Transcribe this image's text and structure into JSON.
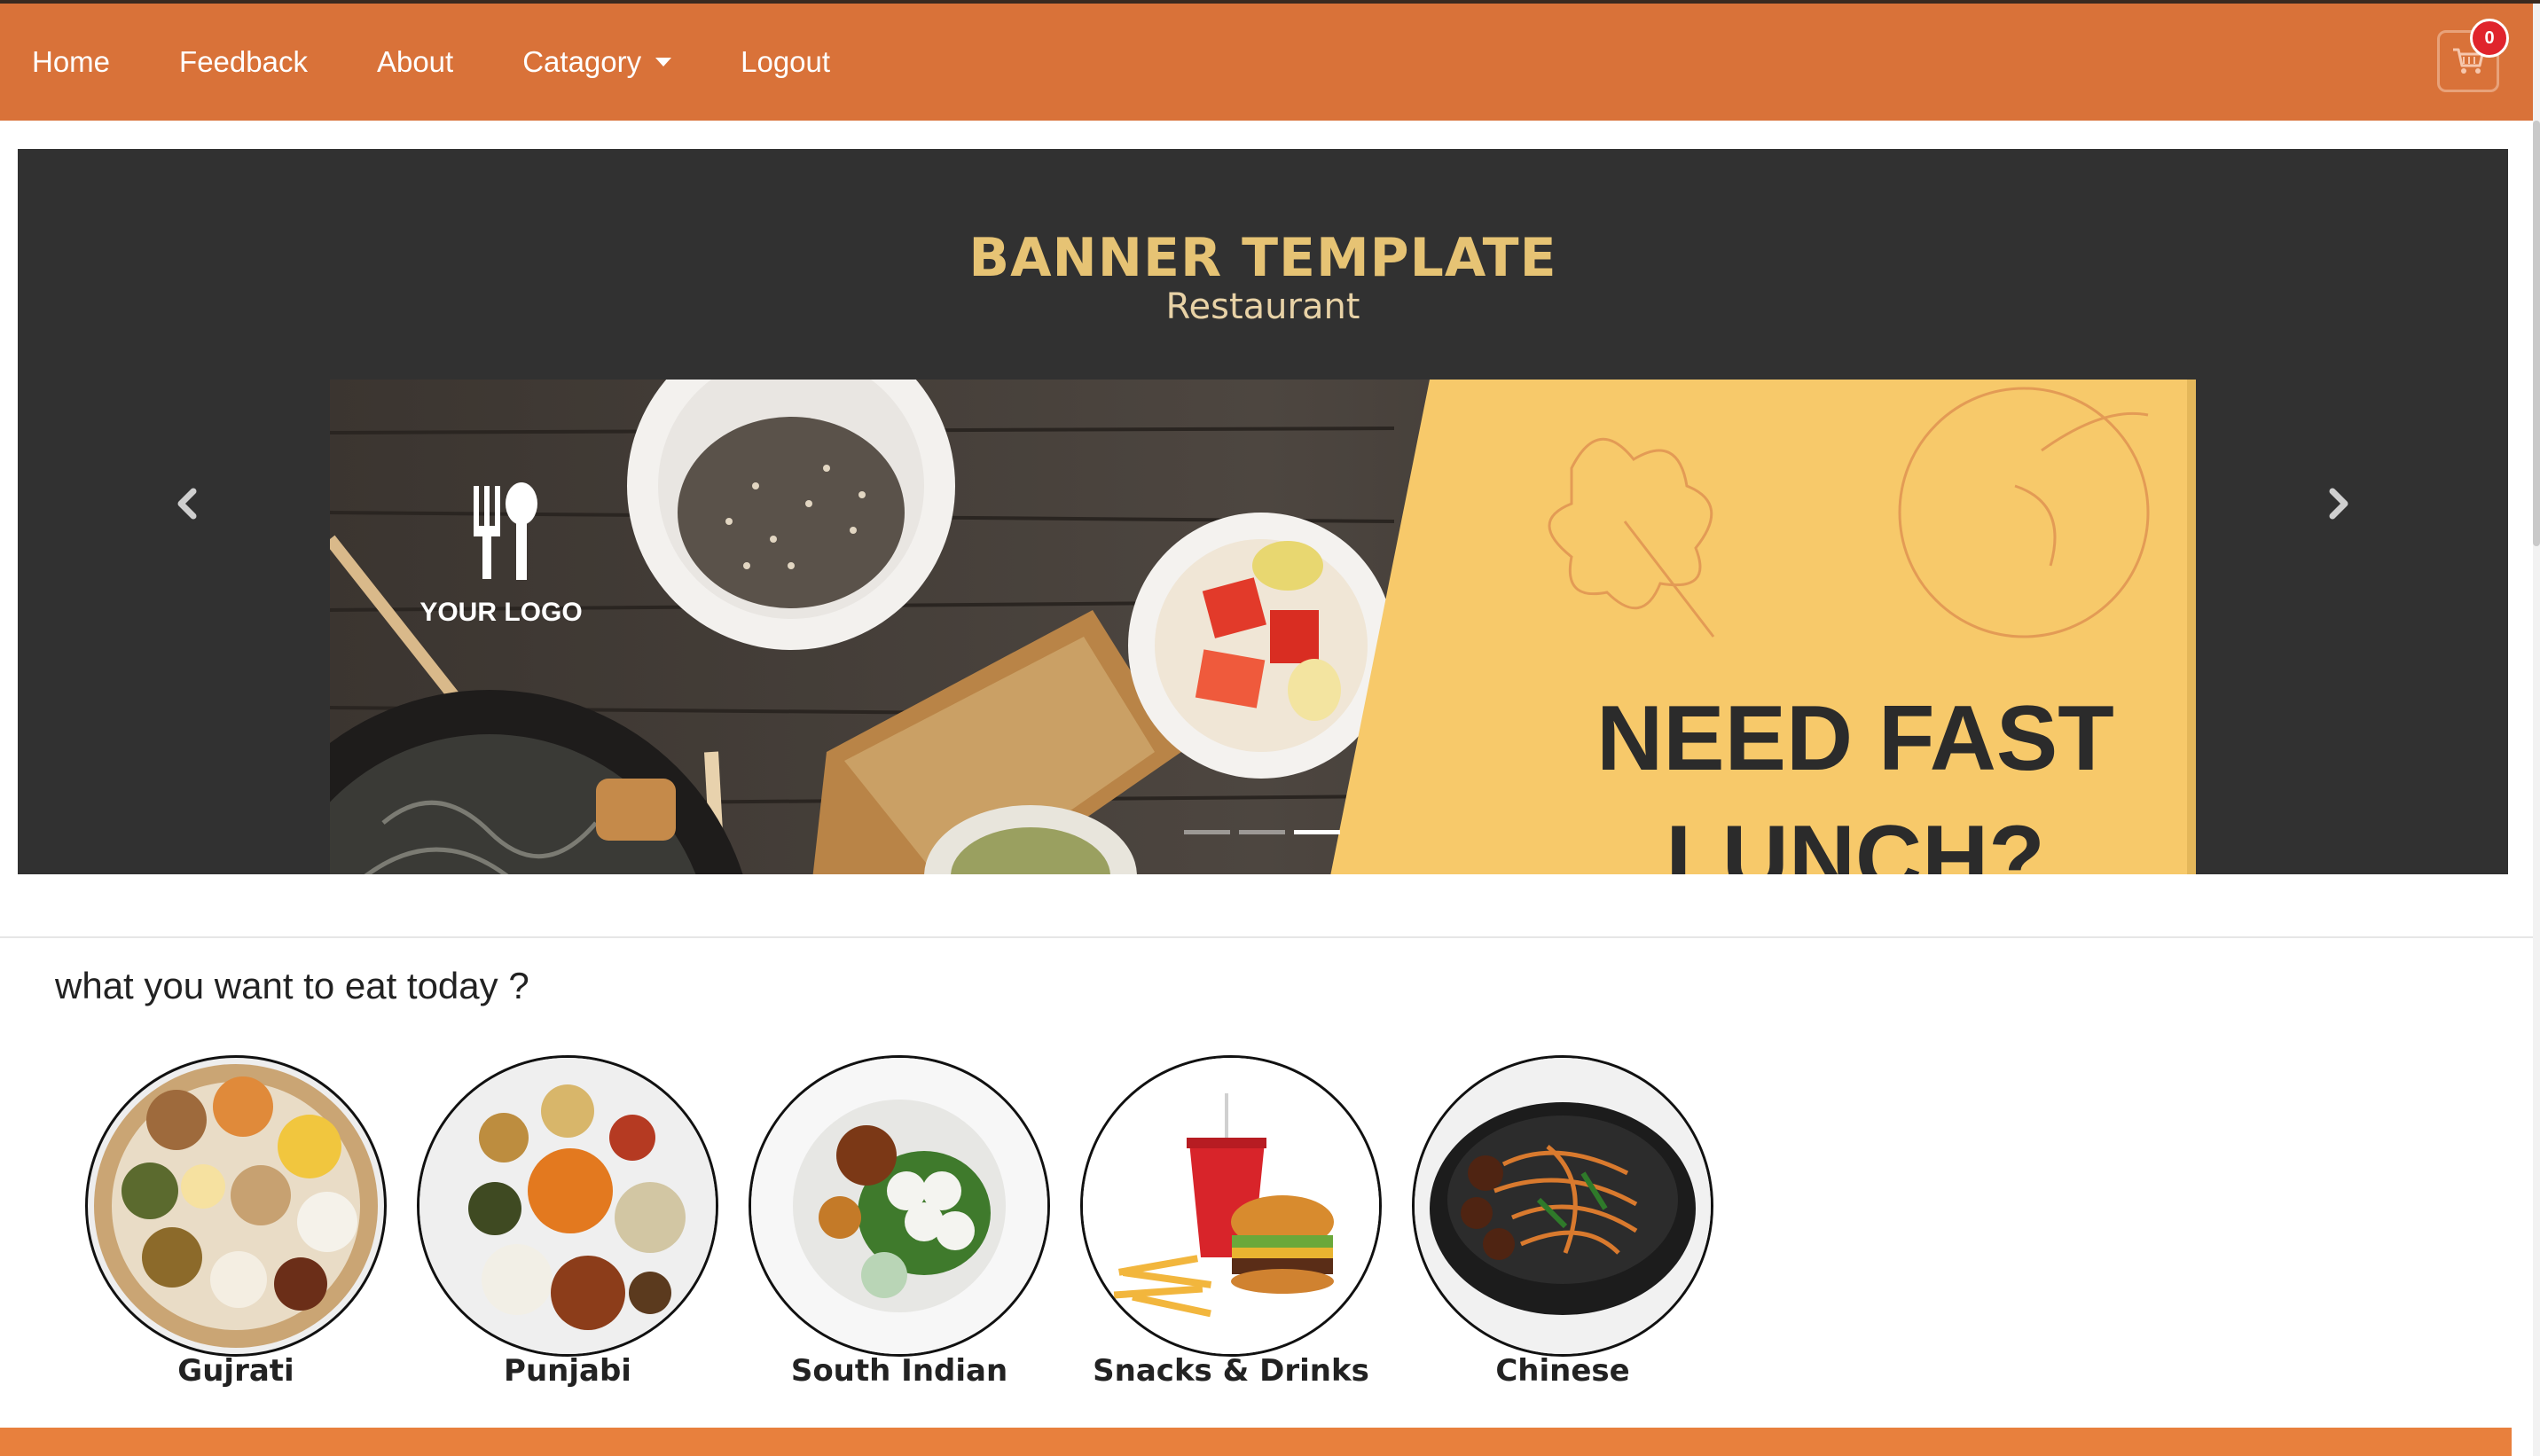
{
  "nav": {
    "items": [
      {
        "label": "Home"
      },
      {
        "label": "Feedback"
      },
      {
        "label": "About"
      },
      {
        "label": "Catagory"
      },
      {
        "label": "Logout"
      }
    ],
    "cart_count": "0",
    "cart_icon": "shopping-cart-icon"
  },
  "banner": {
    "title": "BANNER TEMPLATE",
    "subtitle": "Restaurant",
    "logo_text": "YOUR LOGO",
    "headline_line1": "NEED FAST",
    "headline_line2": "LUNCH?",
    "slide_count": 3,
    "active_slide": 3
  },
  "section": {
    "title": "what you want to eat today ?"
  },
  "categories": [
    {
      "label": "Gujrati"
    },
    {
      "label": "Punjabi"
    },
    {
      "label": "South Indian"
    },
    {
      "label": "Snacks & Drinks"
    },
    {
      "label": "Chinese"
    }
  ],
  "colors": {
    "navbar": "#d97239",
    "carousel_bg": "#313131",
    "banner_title": "#e6c374",
    "footer": "#e8803d",
    "badge": "#e0242c"
  }
}
